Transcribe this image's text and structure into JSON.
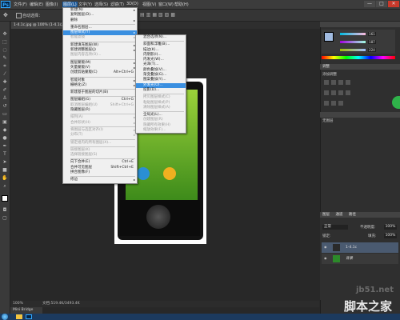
{
  "app": {
    "logo": "Ps",
    "menus": [
      "文件(F)",
      "编辑(E)",
      "图像(I)",
      "图层(L)",
      "文字(Y)",
      "选择(S)",
      "滤镜(T)",
      "3D(D)",
      "视图(V)",
      "窗口(W)",
      "帮助(H)"
    ],
    "active_menu": "图层(L)",
    "window_buttons": [
      "—",
      "□",
      "✕"
    ]
  },
  "options_bar": {
    "auto_select_label": "自动选择："
  },
  "document": {
    "tab_label": "1-4.1c.jpg @ 100% (1-4.1c, RGB/8)",
    "zoom": "100%",
    "doc_info": "文档:519.4K/3493.4K",
    "mini_bridge": "Mini Bridge"
  },
  "layer_menu": {
    "items": [
      {
        "label": "新建(N)",
        "arrow": true
      },
      {
        "label": "复制图层(D)..."
      },
      {
        "label": "删除",
        "arrow": true
      },
      {
        "sep": true
      },
      {
        "label": "重命名图层..."
      },
      {
        "label": "图层样式(Y)",
        "arrow": true,
        "highlight": true
      },
      {
        "label": "智能滤镜",
        "arrow": true,
        "disabled": true
      },
      {
        "sep": true
      },
      {
        "label": "新建填充图层(W)",
        "arrow": true
      },
      {
        "label": "新建调整图层(J)",
        "arrow": true
      },
      {
        "label": "图层内容选项(O)...",
        "disabled": true
      },
      {
        "sep": true
      },
      {
        "label": "图层蒙版(M)",
        "arrow": true
      },
      {
        "label": "矢量蒙版(V)",
        "arrow": true
      },
      {
        "label": "创建剪贴蒙版(C)",
        "shortcut": "Alt+Ctrl+G"
      },
      {
        "sep": true
      },
      {
        "label": "智能对象",
        "arrow": true
      },
      {
        "label": "栅格化(Z)",
        "arrow": true
      },
      {
        "sep": true
      },
      {
        "label": "新建基于图层的切片(B)"
      },
      {
        "sep": true
      },
      {
        "label": "图层编组(G)",
        "shortcut": "Ctrl+G"
      },
      {
        "label": "取消图层编组(U)",
        "shortcut": "Shift+Ctrl+G",
        "disabled": true
      },
      {
        "label": "隐藏图层(R)"
      },
      {
        "sep": true
      },
      {
        "label": "排列(A)",
        "arrow": true,
        "disabled": true
      },
      {
        "label": "合并形状(H)",
        "arrow": true,
        "disabled": true
      },
      {
        "sep": true
      },
      {
        "label": "将图层与选区对齐(I)",
        "arrow": true,
        "disabled": true
      },
      {
        "label": "分布(T)",
        "arrow": true,
        "disabled": true
      },
      {
        "sep": true
      },
      {
        "label": "锁定组内的所有图层(X)...",
        "disabled": true
      },
      {
        "sep": true
      },
      {
        "label": "链接图层(K)",
        "disabled": true
      },
      {
        "label": "选择链接图层(S)",
        "disabled": true
      },
      {
        "sep": true
      },
      {
        "label": "向下合并(E)",
        "shortcut": "Ctrl+E"
      },
      {
        "label": "合并可见图层",
        "shortcut": "Shift+Ctrl+E"
      },
      {
        "label": "拼合图像(F)"
      },
      {
        "sep": true
      },
      {
        "label": "修边",
        "arrow": true
      }
    ]
  },
  "style_submenu": {
    "items": [
      {
        "label": "混合选项(N)..."
      },
      {
        "sep": true
      },
      {
        "label": "斜面和浮雕(B)..."
      },
      {
        "label": "描边(K)..."
      },
      {
        "label": "内阴影(I)..."
      },
      {
        "label": "内发光(W)..."
      },
      {
        "label": "光泽(T)..."
      },
      {
        "label": "颜色叠加(V)..."
      },
      {
        "label": "渐变叠加(G)..."
      },
      {
        "label": "图案叠加(Y)..."
      },
      {
        "label": "外发光(O)...",
        "highlight": true
      },
      {
        "label": "投影(D)..."
      },
      {
        "sep": true
      },
      {
        "label": "拷贝图层样式(C)",
        "disabled": true
      },
      {
        "label": "粘贴图层样式(P)",
        "disabled": true
      },
      {
        "label": "清除图层样式(A)",
        "disabled": true
      },
      {
        "sep": true
      },
      {
        "label": "全局光(L)..."
      },
      {
        "label": "创建图层(R)",
        "disabled": true
      },
      {
        "label": "隐藏所有效果(H)",
        "disabled": true
      },
      {
        "label": "缩放效果(F)...",
        "disabled": true
      }
    ]
  },
  "color_panel": {
    "r": "161",
    "g": "187",
    "b": "224"
  },
  "adjust_panel": {
    "tab": "调整",
    "title": "添加调整"
  },
  "style_panel": {
    "label": "无图层"
  },
  "layers_panel": {
    "tabs": [
      "图层",
      "通道",
      "路径"
    ],
    "blend_mode": "正常",
    "opacity_label": "不透明度:",
    "opacity": "100%",
    "lock_label": "锁定:",
    "fill_label": "填充:",
    "fill": "100%",
    "layers": [
      {
        "name": "1-4.1c",
        "selected": true
      },
      {
        "name": "背景",
        "selected": false
      }
    ]
  },
  "watermark": {
    "line1": "jb51.net",
    "line2": "脚本之家"
  },
  "colors": {
    "menu_highlight": "#3a8fe0",
    "accent": "#31a8ff"
  }
}
